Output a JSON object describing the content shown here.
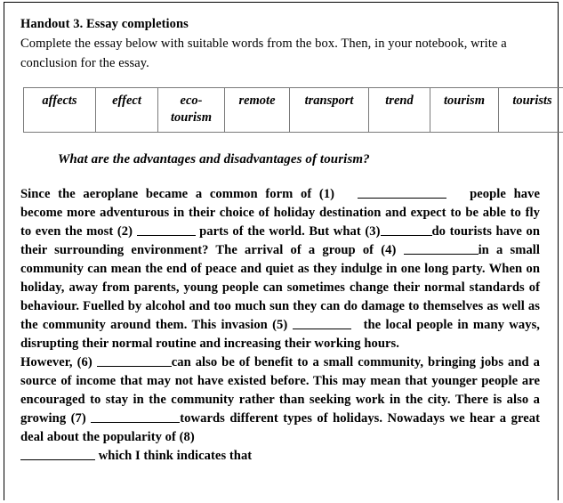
{
  "document": {
    "handout_title": "Handout 3. Essay completions",
    "instructions": "Complete the essay below with suitable words from the box. Then, in your notebook, write a conclusion for the essay.",
    "essay_heading": "What are the advantages and disadvantages of tourism?"
  },
  "word_box": {
    "words": [
      "affects",
      "effect",
      "eco-tourism",
      "remote",
      "transport",
      "trend",
      "tourism",
      "tourists"
    ]
  },
  "essay": {
    "paragraph_1": {
      "seg_1": "Since the aeroplane became a common form of (1)",
      "seg_2": "people have become more adventurous in their choice of holiday destination and expect to be able to fly to even the most (2)",
      "seg_3": "parts of the world. But what (3)",
      "seg_4": "do tourists have on their surrounding environment? The arrival of a group of (4)",
      "seg_5": "in a small community can mean the end of peace and quiet as they indulge in one long party. When on holiday, away from parents, young people can sometimes change their normal standards of behaviour. Fuelled by alcohol and too much sun they can do damage to themselves as well as the community around them. This invasion (5)",
      "seg_6": "the local people in many ways, disrupting their normal routine and increasing their working hours."
    },
    "paragraph_2": {
      "seg_1": "However, (6)",
      "seg_2": "can also be of benefit to a small community, bringing jobs and a source of income that may not have existed before. This may mean that younger people are encouraged to stay in the community rather than seeking work in the city. There is also a growing (7)",
      "seg_3": "towards different types of holidays. Nowadays we hear a great deal about the popularity of (8)",
      "seg_4": "which I think indicates that"
    }
  }
}
